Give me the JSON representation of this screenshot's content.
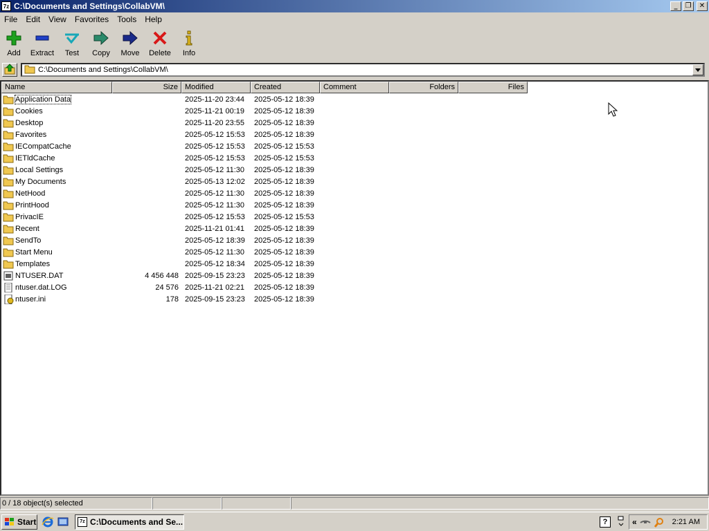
{
  "window": {
    "title": "C:\\Documents and Settings\\CollabVM\\",
    "app_icon_text": "7z",
    "controls": {
      "minimize": "_",
      "restore": "❐",
      "close": "✕"
    }
  },
  "menu": [
    "File",
    "Edit",
    "View",
    "Favorites",
    "Tools",
    "Help"
  ],
  "toolbar": [
    {
      "label": "Add",
      "icon": "add-icon"
    },
    {
      "label": "Extract",
      "icon": "extract-icon"
    },
    {
      "label": "Test",
      "icon": "test-icon"
    },
    {
      "label": "Copy",
      "icon": "copy-icon"
    },
    {
      "label": "Move",
      "icon": "move-icon"
    },
    {
      "label": "Delete",
      "icon": "delete-icon"
    },
    {
      "label": "Info",
      "icon": "info-icon"
    }
  ],
  "address": {
    "path": "C:\\Documents and Settings\\CollabVM\\"
  },
  "columns": [
    "Name",
    "Size",
    "Modified",
    "Created",
    "Comment",
    "Folders",
    "Files"
  ],
  "files": [
    {
      "name": "Application Data",
      "type": "folder",
      "size": "",
      "modified": "2025-11-20 23:44",
      "created": "2025-05-12 18:39"
    },
    {
      "name": "Cookies",
      "type": "folder",
      "size": "",
      "modified": "2025-11-21 00:19",
      "created": "2025-05-12 18:39"
    },
    {
      "name": "Desktop",
      "type": "folder",
      "size": "",
      "modified": "2025-11-20 23:55",
      "created": "2025-05-12 18:39"
    },
    {
      "name": "Favorites",
      "type": "folder",
      "size": "",
      "modified": "2025-05-12 15:53",
      "created": "2025-05-12 18:39"
    },
    {
      "name": "IECompatCache",
      "type": "folder",
      "size": "",
      "modified": "2025-05-12 15:53",
      "created": "2025-05-12 15:53"
    },
    {
      "name": "IETldCache",
      "type": "folder",
      "size": "",
      "modified": "2025-05-12 15:53",
      "created": "2025-05-12 15:53"
    },
    {
      "name": "Local Settings",
      "type": "folder",
      "size": "",
      "modified": "2025-05-12 11:30",
      "created": "2025-05-12 18:39"
    },
    {
      "name": "My Documents",
      "type": "folder",
      "size": "",
      "modified": "2025-05-13 12:02",
      "created": "2025-05-12 18:39"
    },
    {
      "name": "NetHood",
      "type": "folder",
      "size": "",
      "modified": "2025-05-12 11:30",
      "created": "2025-05-12 18:39"
    },
    {
      "name": "PrintHood",
      "type": "folder",
      "size": "",
      "modified": "2025-05-12 11:30",
      "created": "2025-05-12 18:39"
    },
    {
      "name": "PrivacIE",
      "type": "folder",
      "size": "",
      "modified": "2025-05-12 15:53",
      "created": "2025-05-12 15:53"
    },
    {
      "name": "Recent",
      "type": "folder",
      "size": "",
      "modified": "2025-11-21 01:41",
      "created": "2025-05-12 18:39"
    },
    {
      "name": "SendTo",
      "type": "folder",
      "size": "",
      "modified": "2025-05-12 18:39",
      "created": "2025-05-12 18:39"
    },
    {
      "name": "Start Menu",
      "type": "folder",
      "size": "",
      "modified": "2025-05-12 11:30",
      "created": "2025-05-12 18:39"
    },
    {
      "name": "Templates",
      "type": "folder",
      "size": "",
      "modified": "2025-05-12 18:34",
      "created": "2025-05-12 18:39"
    },
    {
      "name": "NTUSER.DAT",
      "type": "dat",
      "size": "4 456 448",
      "modified": "2025-09-15 23:23",
      "created": "2025-05-12 18:39"
    },
    {
      "name": "ntuser.dat.LOG",
      "type": "log",
      "size": "24 576",
      "modified": "2025-11-21 02:21",
      "created": "2025-05-12 18:39"
    },
    {
      "name": "ntuser.ini",
      "type": "ini",
      "size": "178",
      "modified": "2025-09-15 23:23",
      "created": "2025-05-12 18:39"
    }
  ],
  "status": {
    "selection": "0 / 18 object(s) selected"
  },
  "taskbar": {
    "start_label": "Start",
    "task_label": "C:\\Documents and Se...",
    "clock": "2:21 AM",
    "tray_chevron": "«"
  },
  "colors": {
    "title_start": "#0a246a",
    "title_end": "#a6caf0",
    "folder": "#f0c850"
  }
}
